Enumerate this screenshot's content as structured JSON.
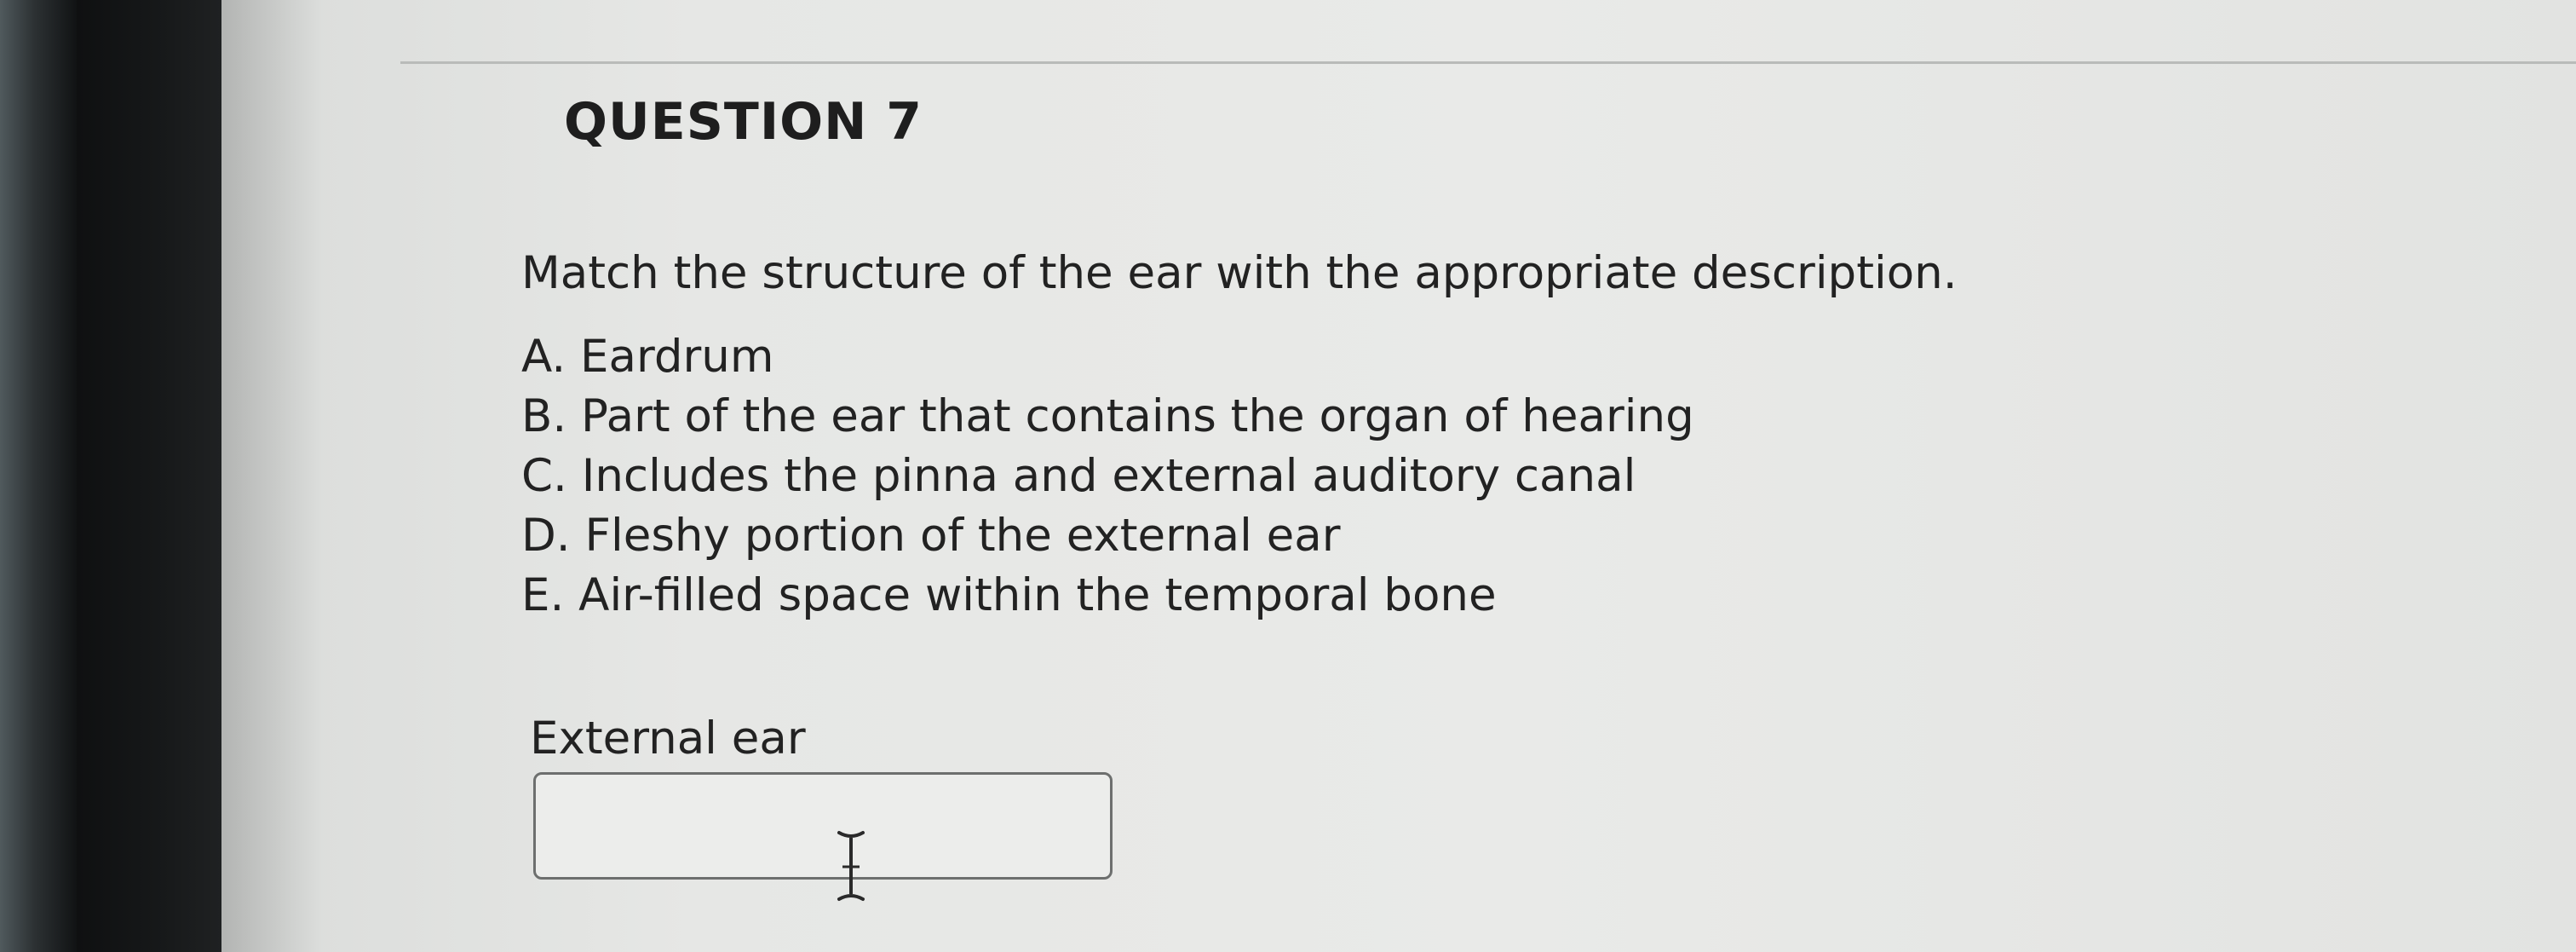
{
  "question": {
    "title": "QUESTION 7",
    "prompt": "Match the structure of the ear with the appropriate description.",
    "options": [
      "A. Eardrum",
      "B. Part of the ear that contains the organ of hearing",
      "C. Includes the pinna and external auditory canal",
      "D. Fleshy portion of the external ear",
      "E. Air-filled space within the temporal bone"
    ]
  },
  "match_item": {
    "label": "External ear",
    "value": ""
  },
  "icons": {
    "cursor": "text-cursor-icon"
  }
}
